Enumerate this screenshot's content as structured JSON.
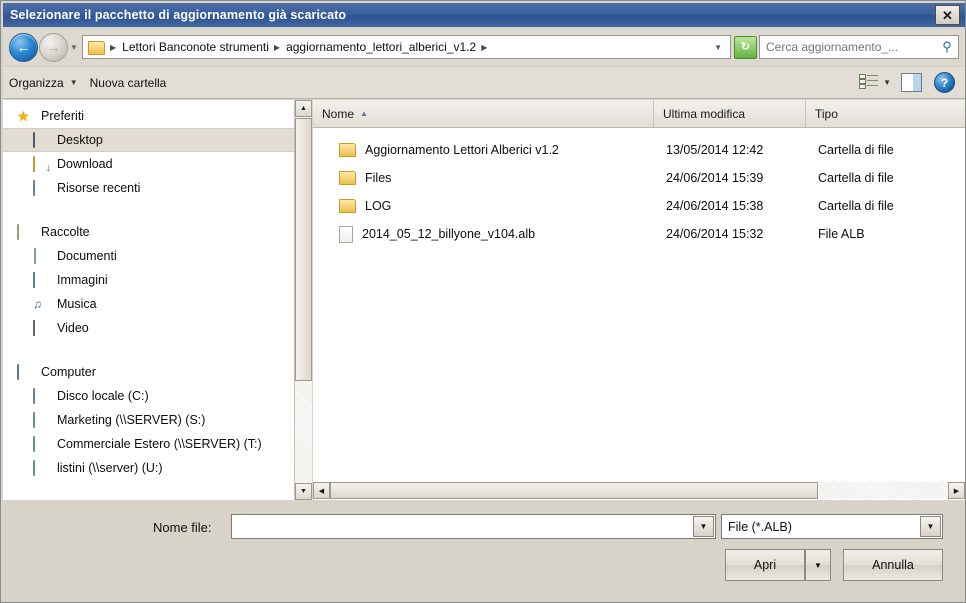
{
  "window": {
    "title": "Selezionare il pacchetto di aggiornamento già scaricato",
    "close_label": "✕"
  },
  "navbar": {
    "back_glyph": "←",
    "forward_glyph": "→",
    "history_glyph": "▼",
    "breadcrumbs": [
      {
        "label": "Lettori Banconote strumenti"
      },
      {
        "label": "aggiornamento_lettori_alberici_v1.2"
      }
    ],
    "separator": "▶",
    "address_dropdown_glyph": "▼",
    "refresh_glyph": "↻",
    "search_placeholder": "Cerca aggiornamento_...",
    "search_value": "",
    "search_icon_glyph": "⚲"
  },
  "toolbar": {
    "organize_label": "Organizza",
    "organize_caret": "▼",
    "new_folder_label": "Nuova cartella",
    "view_caret": "▼",
    "help_label": "?"
  },
  "sidebar": {
    "groups": [
      {
        "header": {
          "label": "Preferiti",
          "icon": "star-icon",
          "icon_glyph": "★"
        },
        "items": [
          {
            "label": "Desktop",
            "icon": "monitor-icon",
            "selected": true
          },
          {
            "label": "Download",
            "icon": "folder-download-icon",
            "selected": false
          },
          {
            "label": "Risorse recenti",
            "icon": "network-recent-icon",
            "selected": false
          }
        ]
      },
      {
        "header": {
          "label": "Raccolte",
          "icon": "library-icon",
          "icon_glyph": ""
        },
        "items": [
          {
            "label": "Documenti",
            "icon": "documents-icon",
            "selected": false
          },
          {
            "label": "Immagini",
            "icon": "pictures-icon",
            "selected": false
          },
          {
            "label": "Musica",
            "icon": "music-icon",
            "selected": false
          },
          {
            "label": "Video",
            "icon": "video-icon",
            "selected": false
          }
        ]
      },
      {
        "header": {
          "label": "Computer",
          "icon": "computer-icon",
          "icon_glyph": ""
        },
        "items": [
          {
            "label": "Disco locale (C:)",
            "icon": "harddisk-icon",
            "selected": false
          },
          {
            "label": "Marketing (\\\\SERVER) (S:)",
            "icon": "network-drive-icon",
            "selected": false
          },
          {
            "label": "Commerciale Estero (\\\\SERVER) (T:)",
            "icon": "network-drive-icon",
            "selected": false
          },
          {
            "label": "listini (\\\\server) (U:)",
            "icon": "network-drive-icon",
            "selected": false
          }
        ]
      }
    ],
    "scroll_up_glyph": "▲",
    "scroll_down_glyph": "▼"
  },
  "filelist": {
    "columns": [
      {
        "label": "Nome",
        "sorted": "asc",
        "sort_glyph": "▲"
      },
      {
        "label": "Ultima modifica",
        "sorted": "",
        "sort_glyph": ""
      },
      {
        "label": "Tipo",
        "sorted": "",
        "sort_glyph": ""
      }
    ],
    "rows": [
      {
        "name": "Aggiornamento Lettori Alberici v1.2",
        "modified": "13/05/2014 12:42",
        "type": "Cartella di file",
        "icon": "folder-icon"
      },
      {
        "name": "Files",
        "modified": "24/06/2014 15:39",
        "type": "Cartella di file",
        "icon": "folder-icon"
      },
      {
        "name": "LOG",
        "modified": "24/06/2014 15:38",
        "type": "Cartella di file",
        "icon": "folder-icon"
      },
      {
        "name": "2014_05_12_billyone_v104.alb",
        "modified": "24/06/2014 15:32",
        "type": "File ALB",
        "icon": "file-icon"
      }
    ],
    "scroll_left_glyph": "◀",
    "scroll_right_glyph": "▶"
  },
  "bottom": {
    "filename_label": "Nome file:",
    "filename_value": "",
    "filename_placeholder": "",
    "filename_dropdown_glyph": "▼",
    "filter_value": "File (*.ALB)",
    "filter_dropdown_glyph": "▼",
    "open_label": "Apri",
    "open_dropdown_glyph": "▼",
    "cancel_label": "Annulla"
  },
  "colors": {
    "titlebar": "#3b5f9c",
    "dialog_face": "#d8d4cb",
    "selection": "#e3dcd2",
    "folder": "#f0bf4c"
  }
}
